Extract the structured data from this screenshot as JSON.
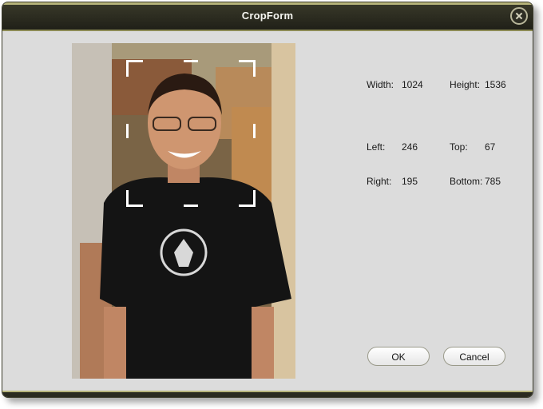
{
  "window": {
    "title": "CropForm"
  },
  "info": {
    "width_label": "Width:",
    "width_value": "1024",
    "height_label": "Height:",
    "height_value": "1536",
    "left_label": "Left:",
    "left_value": "246",
    "top_label": "Top:",
    "top_value": "67",
    "right_label": "Right:",
    "right_value": "195",
    "bottom_label": "Bottom:",
    "bottom_value": "785"
  },
  "buttons": {
    "ok": "OK",
    "cancel": "Cancel"
  },
  "colors": {
    "titlebar": "#202018",
    "accent": "#b6b37a",
    "background": "#dcdcdc"
  }
}
